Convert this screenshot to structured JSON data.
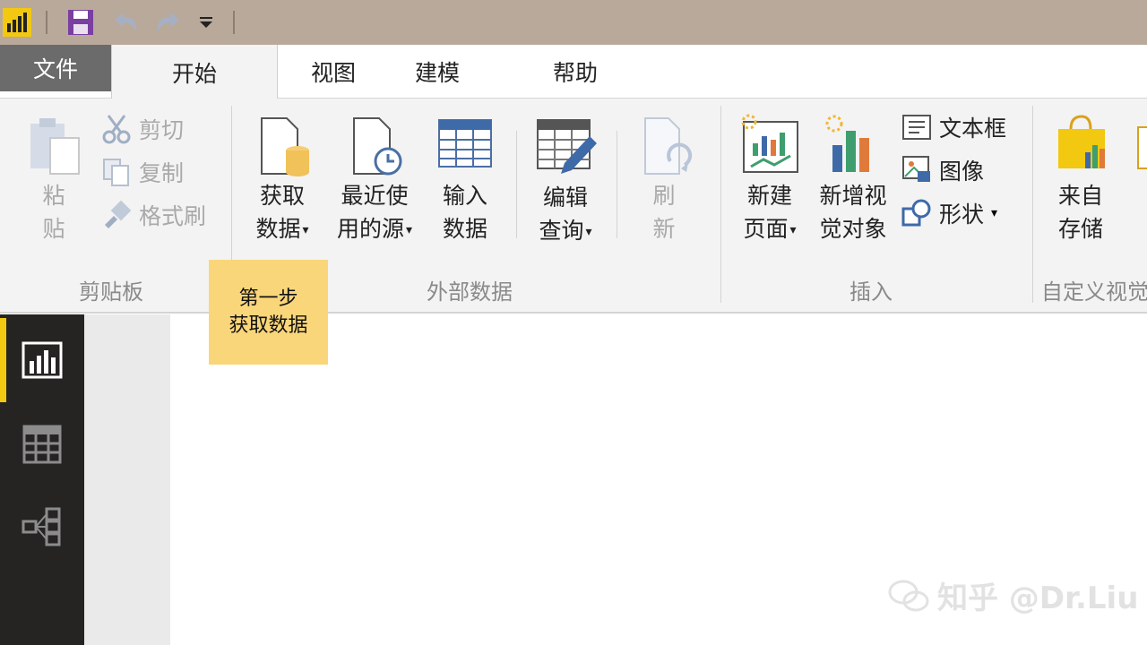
{
  "quick_access": {
    "icons": [
      "powerbi-logo-icon",
      "save-icon",
      "undo-icon",
      "redo-icon",
      "customize-dropdown-icon"
    ]
  },
  "tabs": {
    "file": "文件",
    "home": "开始",
    "view": "视图",
    "modeling": "建模",
    "help": "帮助"
  },
  "ribbon": {
    "clipboard": {
      "paste_line1": "粘",
      "paste_line2": "贴",
      "cut": "剪切",
      "copy": "复制",
      "format_painter": "格式刷",
      "group": "剪贴板"
    },
    "external_data": {
      "get_data_line1": "获取",
      "get_data_line2": "数据",
      "recent_sources_line1": "最近使",
      "recent_sources_line2": "用的源",
      "enter_data_line1": "输入",
      "enter_data_line2": "数据",
      "edit_queries_line1": "编辑",
      "edit_queries_line2": "查询",
      "refresh_line1": "刷",
      "refresh_line2": "新",
      "group": "外部数据"
    },
    "insert": {
      "new_page_line1": "新建",
      "new_page_line2": "页面",
      "new_visual_line1": "新增视",
      "new_visual_line2": "觉对象",
      "text_box": "文本框",
      "image": "图像",
      "shapes": "形状",
      "group": "插入"
    },
    "custom_visuals": {
      "from_store_line1": "来自",
      "from_store_line2": "存储",
      "group": "自定义视觉"
    },
    "dropdown_caret": "▾"
  },
  "annotation": {
    "line1": "第一步",
    "line2": "获取数据"
  },
  "left_nav": {
    "items": [
      "report-view-icon",
      "data-view-icon",
      "relationships-view-icon"
    ],
    "active": "report-view-icon"
  },
  "watermark": {
    "text": "知乎 @Dr.Liu"
  },
  "colors": {
    "title_bar": "#b9a99a",
    "file_tab": "#6b6b6b",
    "ribbon_bg": "#f3f3f3",
    "left_nav_bg": "#252423",
    "accent_yellow": "#f2c811",
    "sticky_note": "#fad67a"
  }
}
